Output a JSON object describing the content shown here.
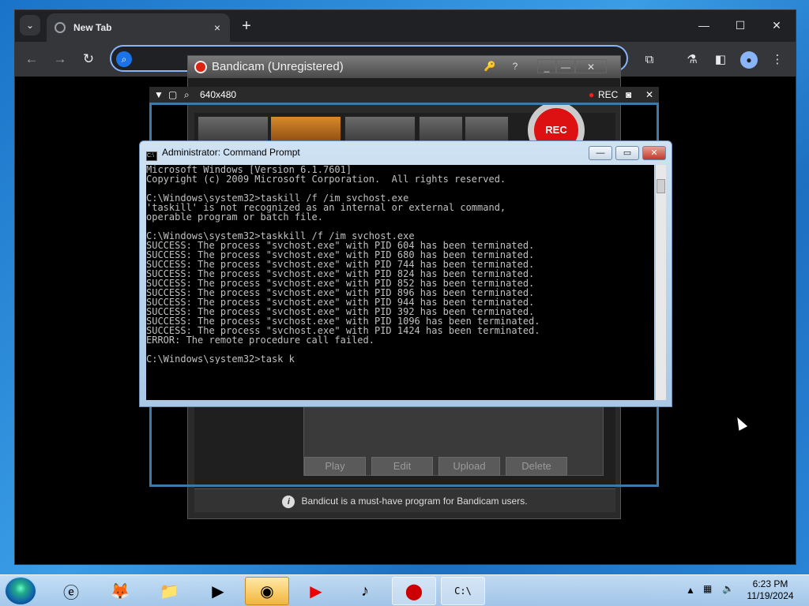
{
  "browser": {
    "tab_title": "New Tab",
    "tab_close": "×",
    "new_tab": "+",
    "win_minimize": "—",
    "win_maximize": "☐",
    "win_close": "✕",
    "back": "←",
    "forward": "→",
    "reload": "↻"
  },
  "bandicam": {
    "title": "Bandicam (Unregistered)",
    "key_icon": "🔑",
    "help": "?",
    "minimize_small": "_",
    "minimize": "—",
    "close": "✕",
    "rec_label": "REC",
    "buttons": [
      "Play",
      "Edit",
      "Upload",
      "Delete"
    ],
    "footer_text": "Bandicut is a must-have program for Bandicam users.",
    "overlay": {
      "resolution": "640x480",
      "rec": "REC",
      "close": "✕"
    }
  },
  "cmd": {
    "title": "Administrator: Command Prompt",
    "lines": [
      "Microsoft Windows [Version 6.1.7601]",
      "Copyright (c) 2009 Microsoft Corporation.  All rights reserved.",
      "",
      "C:\\Windows\\system32>taskill /f /im svchost.exe",
      "'taskill' is not recognized as an internal or external command,",
      "operable program or batch file.",
      "",
      "C:\\Windows\\system32>taskkill /f /im svchost.exe",
      "SUCCESS: The process \"svchost.exe\" with PID 604 has been terminated.",
      "SUCCESS: The process \"svchost.exe\" with PID 680 has been terminated.",
      "SUCCESS: The process \"svchost.exe\" with PID 744 has been terminated.",
      "SUCCESS: The process \"svchost.exe\" with PID 824 has been terminated.",
      "SUCCESS: The process \"svchost.exe\" with PID 852 has been terminated.",
      "SUCCESS: The process \"svchost.exe\" with PID 896 has been terminated.",
      "SUCCESS: The process \"svchost.exe\" with PID 944 has been terminated.",
      "SUCCESS: The process \"svchost.exe\" with PID 392 has been terminated.",
      "SUCCESS: The process \"svchost.exe\" with PID 1096 has been terminated.",
      "SUCCESS: The process \"svchost.exe\" with PID 1424 has been terminated.",
      "ERROR: The remote procedure call failed.",
      "",
      "C:\\Windows\\system32>task k"
    ]
  },
  "taskbar": {
    "apps": [
      "start-icon",
      "internet-explorer-icon",
      "firefox-icon",
      "file-explorer-icon",
      "media-player-icon",
      "bandicam-preview-icon",
      "youtube-icon",
      "tiktok-icon",
      "bandicam-icon",
      "cmd-icon"
    ],
    "time": "6:23 PM",
    "date": "11/19/2024"
  }
}
